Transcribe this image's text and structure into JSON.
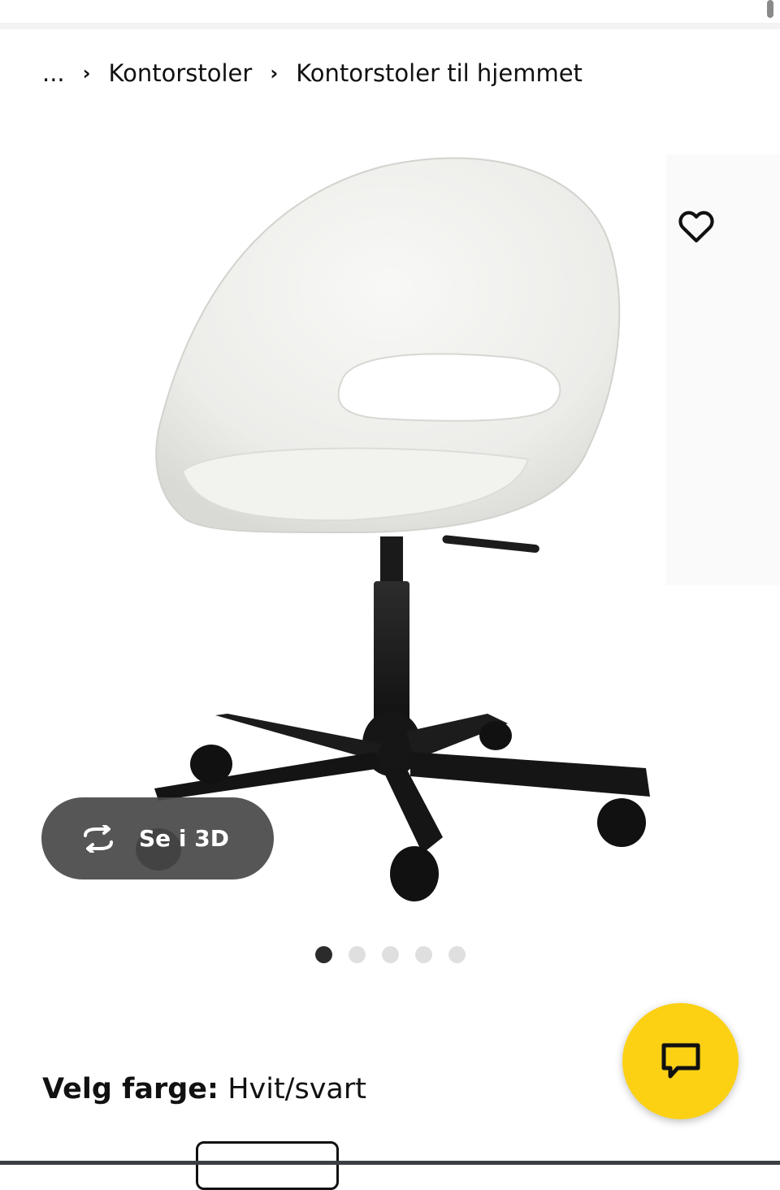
{
  "breadcrumb": {
    "ellipsis": "...",
    "separator": "›",
    "items": [
      {
        "label": "Kontorstoler"
      },
      {
        "label": "Kontorstoler til hjemmet"
      }
    ]
  },
  "product": {
    "image_alt": "Hvit kontorstol med svart understell",
    "view_3d_label": "Se i 3D",
    "gallery_count": 5,
    "gallery_active": 1,
    "favorite_icon": "heart-outline-icon"
  },
  "color_select": {
    "label": "Velg farge:",
    "value": "Hvit/svart"
  },
  "chat": {
    "icon": "chat-bubble-icon",
    "color": "#fcd114"
  }
}
